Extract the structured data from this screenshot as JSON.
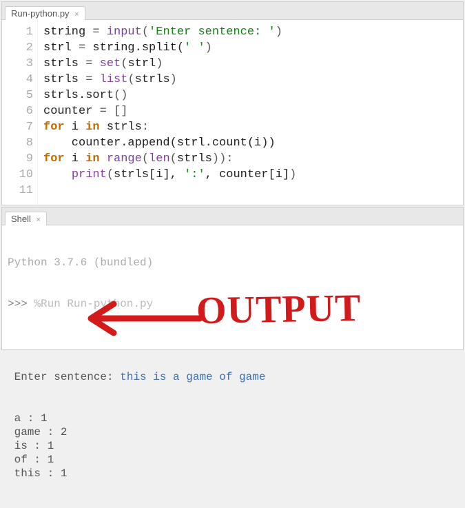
{
  "editor": {
    "tab_label": "Run-python.py",
    "line_numbers": [
      "1",
      "2",
      "3",
      "4",
      "5",
      "6",
      "7",
      "8",
      "9",
      "10",
      "11"
    ],
    "code": [
      {
        "n": "1",
        "seg": [
          [
            "",
            "string "
          ],
          [
            "op",
            "="
          ],
          [
            "",
            " "
          ],
          [
            "builtin",
            "input"
          ],
          [
            "op",
            "("
          ],
          [
            "str",
            "'Enter sentence: '"
          ],
          [
            "op",
            ")"
          ]
        ]
      },
      {
        "n": "2",
        "seg": [
          [
            "",
            "strl "
          ],
          [
            "op",
            "="
          ],
          [
            "",
            " string.split("
          ],
          [
            "str",
            "' '"
          ],
          [
            "op",
            ")"
          ]
        ]
      },
      {
        "n": "3",
        "seg": [
          [
            "",
            "strls "
          ],
          [
            "op",
            "="
          ],
          [
            "",
            " "
          ],
          [
            "builtin",
            "set"
          ],
          [
            "op",
            "("
          ],
          [
            "",
            "strl"
          ],
          [
            "op",
            ")"
          ]
        ]
      },
      {
        "n": "4",
        "seg": [
          [
            "",
            "strls "
          ],
          [
            "op",
            "="
          ],
          [
            "",
            " "
          ],
          [
            "builtin",
            "list"
          ],
          [
            "op",
            "("
          ],
          [
            "",
            "strls"
          ],
          [
            "op",
            ")"
          ]
        ]
      },
      {
        "n": "5",
        "seg": [
          [
            "",
            "strls.sort"
          ],
          [
            "op",
            "()"
          ]
        ]
      },
      {
        "n": "6",
        "seg": [
          [
            "",
            "counter "
          ],
          [
            "op",
            "="
          ],
          [
            "",
            " "
          ],
          [
            "op",
            "[]"
          ]
        ]
      },
      {
        "n": "7",
        "seg": [
          [
            "kw",
            "for"
          ],
          [
            "",
            " i "
          ],
          [
            "kw",
            "in"
          ],
          [
            "",
            " strls"
          ],
          [
            "op",
            ":"
          ]
        ]
      },
      {
        "n": "8",
        "seg": [
          [
            "",
            "    counter.append(strl.count(i))"
          ]
        ]
      },
      {
        "n": "9",
        "seg": [
          [
            "kw",
            "for"
          ],
          [
            "",
            " i "
          ],
          [
            "kw",
            "in"
          ],
          [
            "",
            " "
          ],
          [
            "builtin",
            "range"
          ],
          [
            "op",
            "("
          ],
          [
            "builtin",
            "len"
          ],
          [
            "op",
            "("
          ],
          [
            "",
            "strls"
          ],
          [
            "op",
            "))"
          ],
          [
            "op",
            ":"
          ]
        ]
      },
      {
        "n": "10",
        "seg": [
          [
            "",
            "    "
          ],
          [
            "builtin",
            "print"
          ],
          [
            "op",
            "("
          ],
          [
            "",
            "strls[i], "
          ],
          [
            "str",
            "':'"
          ],
          [
            "",
            ", counter[i]"
          ],
          [
            "op",
            ")"
          ]
        ]
      }
    ]
  },
  "shell": {
    "tab_label": "Shell",
    "version_line": "Python 3.7.6 (bundled)",
    "prompt": ">>>",
    "run_cmd": "%Run Run-python.py",
    "input_prompt": " Enter sentence: ",
    "user_input": "this is a game of game",
    "output": [
      " a : 1",
      " game : 2",
      " is : 1",
      " of : 1",
      " this : 1"
    ]
  },
  "annotation": {
    "text": "OUTPUT"
  }
}
